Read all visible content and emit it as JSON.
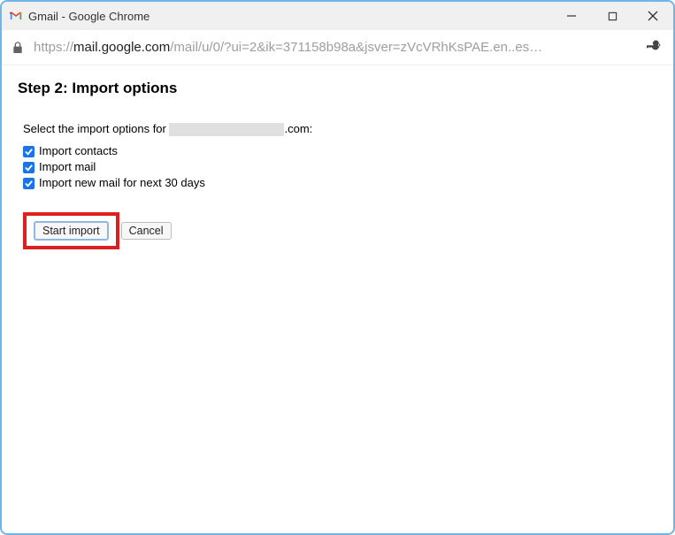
{
  "window": {
    "title": "Gmail - Google Chrome"
  },
  "addressbar": {
    "url_prefix": "https://",
    "url_host": "mail.google.com",
    "url_path": "/mail/u/0/?ui=2&ik=371158b98a&jsver=zVcVRhKsPAE.en..es…"
  },
  "page": {
    "heading": "Step 2: Import options",
    "select_prefix": "Select the import options for ",
    "select_suffix": ".com:",
    "options": [
      {
        "label": "Import contacts",
        "checked": true
      },
      {
        "label": "Import mail",
        "checked": true
      },
      {
        "label": "Import new mail for next 30 days",
        "checked": true
      }
    ],
    "buttons": {
      "start": "Start import",
      "cancel": "Cancel"
    }
  }
}
